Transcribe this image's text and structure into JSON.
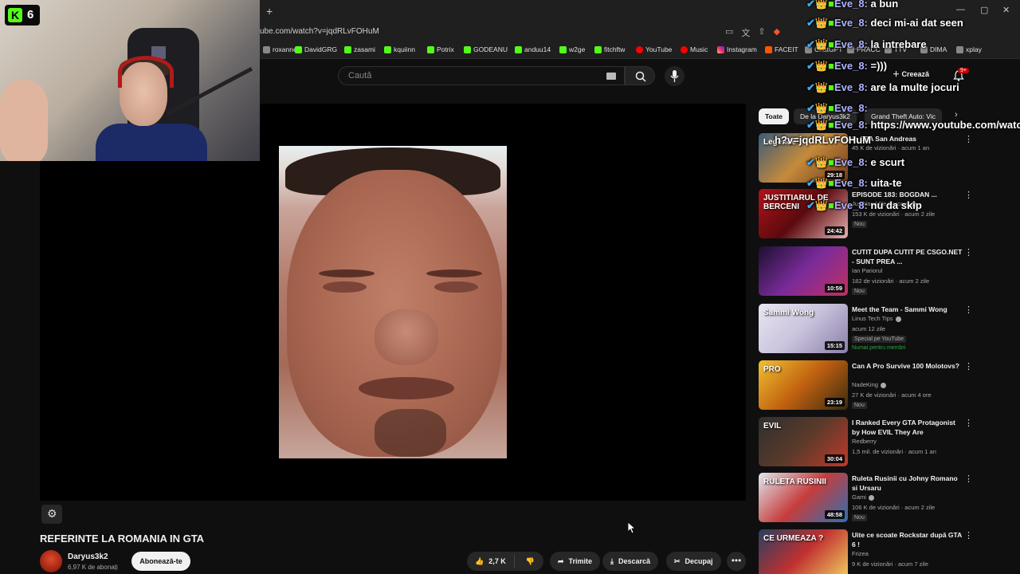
{
  "browser": {
    "url": "ube.com/watch?v=jqdRLvFOHuM",
    "new_tab": "+",
    "bookmarks": [
      {
        "label": "roxanne",
        "icon": "dark"
      },
      {
        "label": "DavidGRG",
        "icon": "kick"
      },
      {
        "label": "zasami",
        "icon": "kick"
      },
      {
        "label": "kquiinn",
        "icon": "kick"
      },
      {
        "label": "Potrix",
        "icon": "kick"
      },
      {
        "label": "GODEANU",
        "icon": "kick"
      },
      {
        "label": "anduu14",
        "icon": "kick"
      },
      {
        "label": "w2ge",
        "icon": "kick"
      },
      {
        "label": "fitchftw",
        "icon": "kick"
      },
      {
        "label": "YouTube",
        "icon": "youtube"
      },
      {
        "label": "Music",
        "icon": "youtube"
      },
      {
        "label": "Instagram",
        "icon": "instagram"
      },
      {
        "label": "FACEIT",
        "icon": "faceit"
      },
      {
        "label": "ChatGPT",
        "icon": "dark"
      },
      {
        "label": "PRACC",
        "icon": "dark"
      },
      {
        "label": "TTV",
        "icon": "dark"
      },
      {
        "label": "DIMA",
        "icon": "dark"
      },
      {
        "label": "xplay",
        "icon": "dark"
      }
    ]
  },
  "youtube": {
    "search_placeholder": "Caută",
    "create_label": "Creează",
    "notif_count": "9+",
    "video": {
      "title": "REFERINTE LA ROMANIA IN GTA",
      "channel": "Daryus3k2",
      "subscribers": "6,97 K de abonați",
      "subscribe_label": "Abonează-te",
      "likes": "2,7 K",
      "share_label": "Trimite",
      "download_label": "Descarcă",
      "clip_label": "Decupaj"
    },
    "chips": [
      "Toate",
      "De la Daryus3k2",
      "Grand Theft Auto: Vic"
    ],
    "recommendations": [
      {
        "title": "in GTA San Andreas",
        "channel": "",
        "meta": "45 K de vizionări · acum 1 an",
        "duration": "29:18",
        "badge": "",
        "badge2": "",
        "thumb_text": "Legende"
      },
      {
        "title": "EPISODE 183: BOGDAN ...",
        "channel": "Justitiarul De Berceni",
        "meta": "153 K de vizionări · acum 2 zile",
        "duration": "24:42",
        "badge": "Nou",
        "badge2": "",
        "thumb_text": "JUSTITIARUL DE BERCENI"
      },
      {
        "title": "CUTIT DUPA CUTIT PE CSGO.NET - SUNT PREA ...",
        "channel": "Ian Pariorul",
        "meta": "182 de vizionări · acum 2 zile",
        "duration": "10:59",
        "badge": "Nou",
        "badge2": "",
        "thumb_text": ""
      },
      {
        "title": "Meet the Team - Sammi Wong",
        "channel": "Linus Tech Tips",
        "meta": "acum 12 zile",
        "duration": "15:15",
        "badge": "Special pe YouTube",
        "badge2": "Numai pentru membri",
        "thumb_text": "Sammi Wong"
      },
      {
        "title": "Can A Pro Survive 100 Molotovs?",
        "channel": "NadeKing",
        "meta": "27 K de vizionări · acum 4 ore",
        "duration": "23:19",
        "badge": "Nou",
        "badge2": "",
        "thumb_text": "PRO"
      },
      {
        "title": "I Ranked Every GTA Protagonist by How EVIL They Are",
        "channel": "Redberry",
        "meta": "1,5 mil. de vizionări · acum 1 an",
        "duration": "30:04",
        "badge": "",
        "badge2": "",
        "thumb_text": "EVIL"
      },
      {
        "title": "Ruleta Rusinii cu Johny Romano si Ursaru",
        "channel": "Gami",
        "meta": "106 K de vizionări · acum 2 zile",
        "duration": "48:58",
        "badge": "Nou",
        "badge2": "",
        "thumb_text": "RULETA RUSINII"
      },
      {
        "title": "Uite ce scoate Rockstar după GTA 6 !",
        "channel": "Frizea",
        "meta": "9 K de vizionări · acum 7 zile",
        "duration": "",
        "badge": "",
        "badge2": "",
        "thumb_text": "CE URMEAZA ?"
      }
    ]
  },
  "chat": {
    "messages": [
      {
        "user": "Eve_8:",
        "text": "a bun"
      },
      {
        "user": "Eve_8:",
        "text": "deci mi-ai dat seen"
      },
      {
        "user": "Eve_8:",
        "text": "la intrebare"
      },
      {
        "user": "Eve_8:",
        "text": "=)))"
      },
      {
        "user": "Eve_8:",
        "text": "are la multe jocuri"
      },
      {
        "user": "Eve_8:",
        "text": ""
      },
      {
        "user": "Eve_8:",
        "text": "https://www.youtube.com/watc"
      },
      {
        "user": "",
        "text": "h?v=jqdRLvFOHuM"
      },
      {
        "user": "Eve_8:",
        "text": "e scurt"
      },
      {
        "user": "Eve_8:",
        "text": "uita-te"
      },
      {
        "user": "Eve_8:",
        "text": "nu da skip"
      }
    ]
  },
  "stream": {
    "platform_letter": "K",
    "viewer_count": "6"
  },
  "colors": {
    "kick_green": "#53fc18",
    "youtube_red": "#ff0000",
    "chat_username": "#b1b1ff"
  }
}
